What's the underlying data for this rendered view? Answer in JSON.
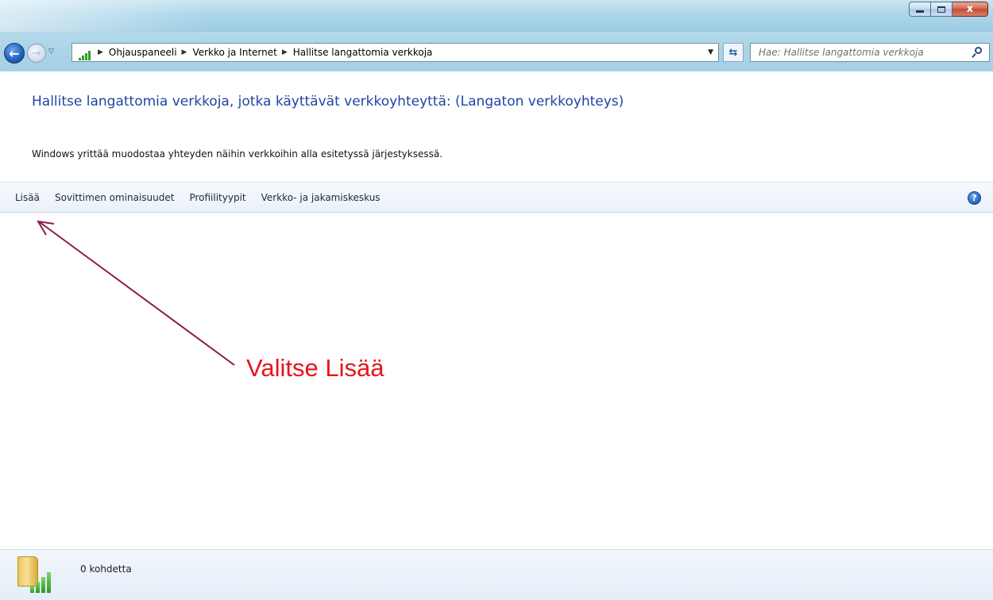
{
  "window": {
    "close_glyph": "x"
  },
  "address_bar": {
    "breadcrumbs": [
      {
        "label": "Ohjauspaneeli"
      },
      {
        "label": "Verkko ja Internet"
      },
      {
        "label": "Hallitse langattomia verkkoja"
      }
    ]
  },
  "search": {
    "placeholder": "Hae: Hallitse langattomia verkkoja"
  },
  "content": {
    "heading": "Hallitse langattomia verkkoja, jotka käyttävät verkkoyhteyttä: (Langaton verkkoyhteys)",
    "description": "Windows yrittää muodostaa yhteyden näihin verkkoihin alla esitetyssä järjestyksessä."
  },
  "toolbar": {
    "items": [
      {
        "label": "Lisää"
      },
      {
        "label": "Sovittimen ominaisuudet"
      },
      {
        "label": "Profiilityypit"
      },
      {
        "label": "Verkko- ja jakamiskeskus"
      }
    ],
    "help_glyph": "?"
  },
  "annotation": {
    "text": "Valitse Lisää",
    "arrow_color": "#8b1a4f",
    "text_color": "#e8141a"
  },
  "status": {
    "item_count": "0 kohdetta"
  }
}
